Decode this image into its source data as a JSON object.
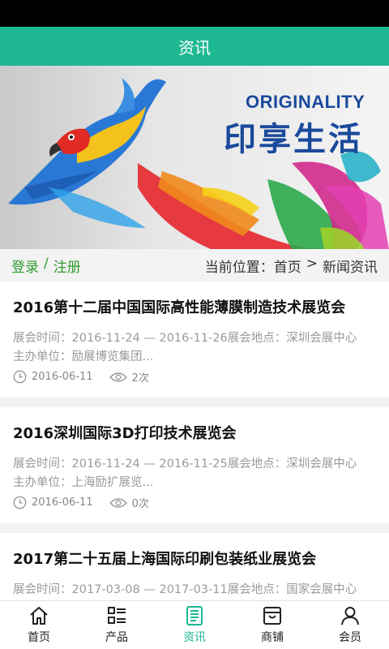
{
  "header": {
    "title": "资讯"
  },
  "banner": {
    "brand_en": "ORIGINALITY",
    "brand_cn": "印享生活"
  },
  "subnav": {
    "login": "登录",
    "separator": "/",
    "register": "注册",
    "location_label": "当前位置：",
    "home": "首页",
    "arrow": ">",
    "current": "新闻资讯"
  },
  "articles": [
    {
      "title": "2016第十二届中国国际高性能薄膜制造技术展览会",
      "line1": "展会时间：2016-11-24 — 2016-11-26展会地点：深圳会展中心",
      "line2": "主办单位：励展博览集团...",
      "date": "2016-06-11",
      "views": "2次"
    },
    {
      "title": "2016深圳国际3D打印技术展览会",
      "line1": "展会时间：2016-11-24 — 2016-11-25展会地点：深圳会展中心",
      "line2": "主办单位：上海励扩展览...",
      "date": "2016-06-11",
      "views": "0次"
    },
    {
      "title": "2017第二十五届上海国际印刷包装纸业展览会",
      "line1": "展会时间：2017-03-08 — 2017-03-11展会地点：国家会展中心",
      "line2": "",
      "date": "",
      "views": ""
    }
  ],
  "tabs": [
    {
      "label": "首页",
      "icon": "home-icon"
    },
    {
      "label": "产品",
      "icon": "list-icon"
    },
    {
      "label": "资讯",
      "icon": "news-icon",
      "active": true
    },
    {
      "label": "商铺",
      "icon": "shop-icon"
    },
    {
      "label": "会员",
      "icon": "user-icon"
    }
  ],
  "colors": {
    "primary": "#1db892",
    "auth_link": "#2f9c2f",
    "brand_blue": "#1a4a9c"
  }
}
